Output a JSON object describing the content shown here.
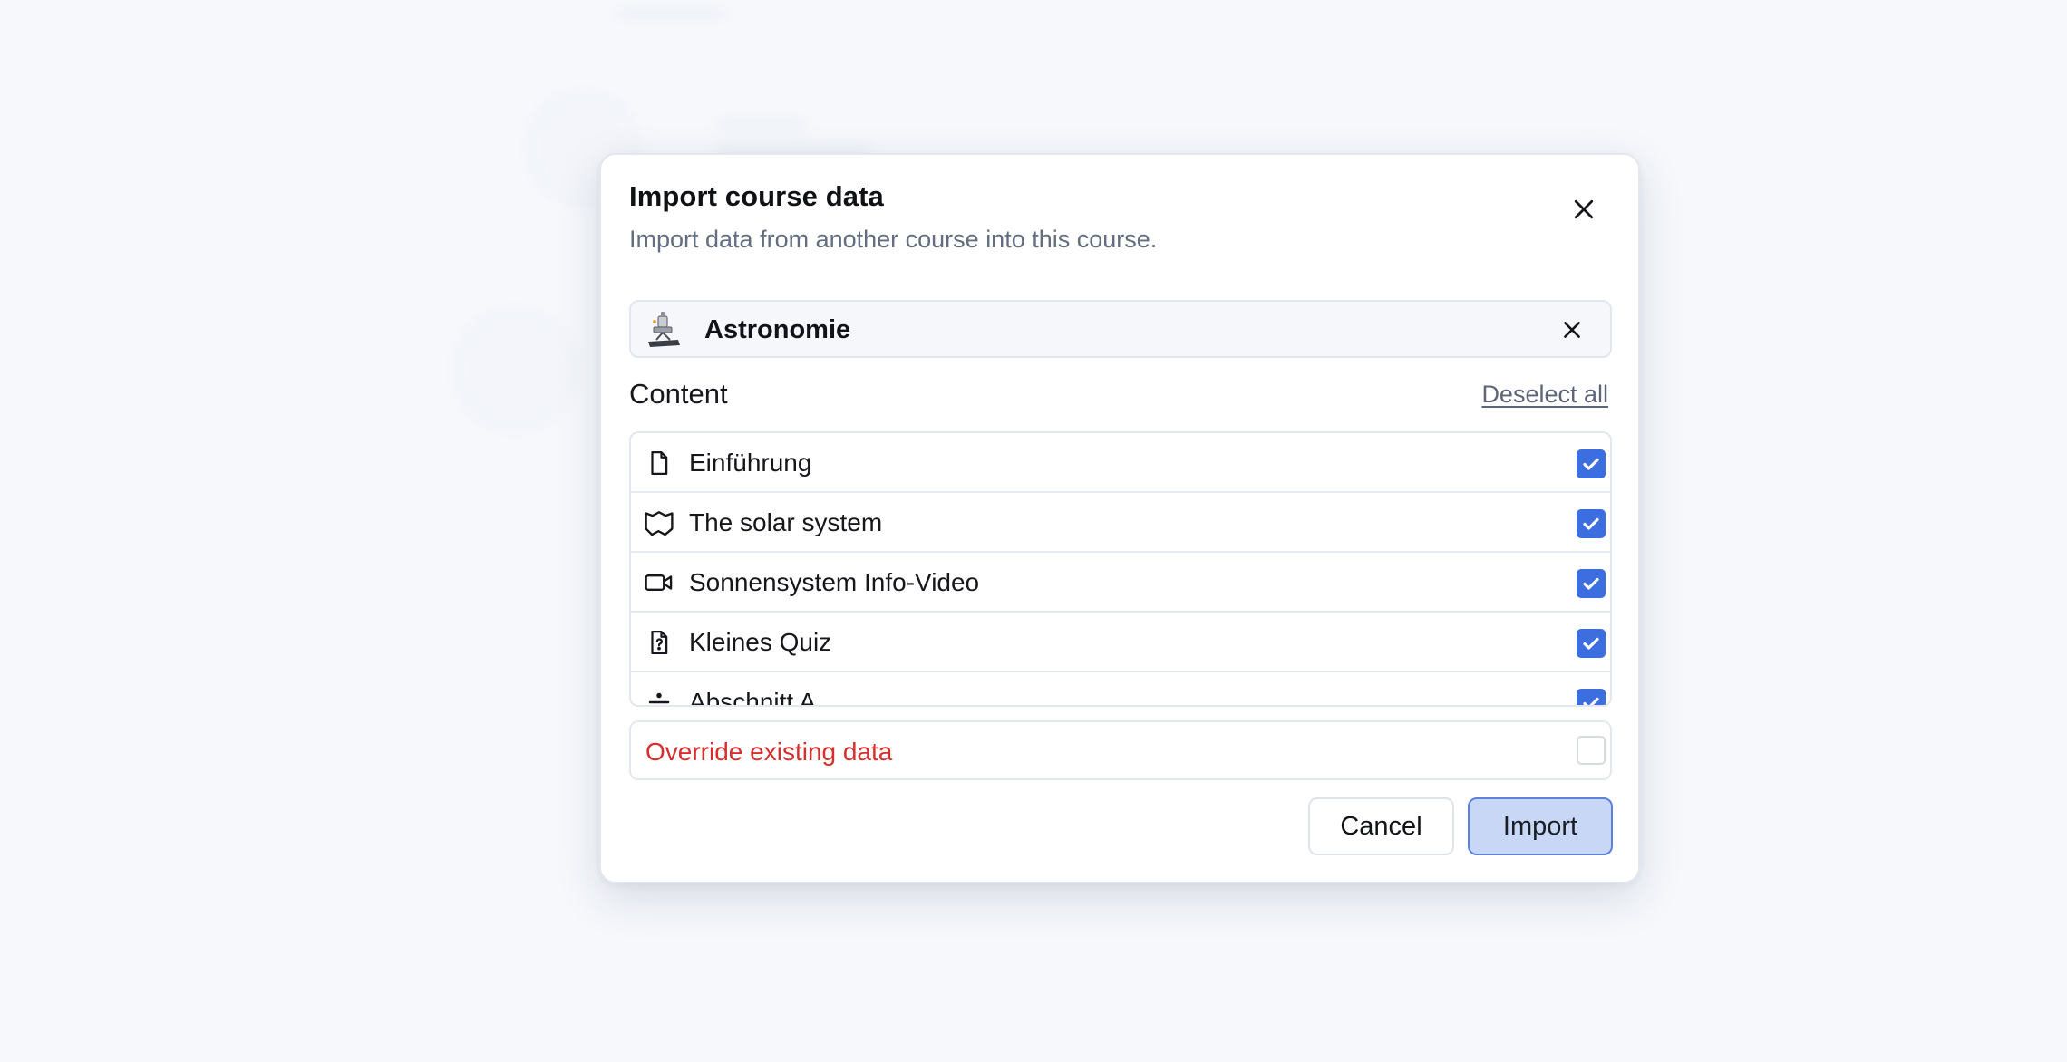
{
  "dialog": {
    "title": "Import course data",
    "subtitle": "Import data from another course into this course."
  },
  "course": {
    "name": "Astronomie"
  },
  "content": {
    "label": "Content",
    "deselect_all": "Deselect all",
    "items": [
      {
        "label": "Einführung",
        "icon": "document-icon",
        "checked": true
      },
      {
        "label": "The solar system",
        "icon": "map-icon",
        "checked": true
      },
      {
        "label": "Sonnensystem Info-Video",
        "icon": "video-icon",
        "checked": true
      },
      {
        "label": "Kleines Quiz",
        "icon": "quiz-icon",
        "checked": true
      },
      {
        "label": "Abschnitt A",
        "icon": "divider-icon",
        "checked": true
      }
    ]
  },
  "override": {
    "label": "Override existing data",
    "checked": false
  },
  "actions": {
    "cancel": "Cancel",
    "import": "Import"
  },
  "colors": {
    "accent": "#3d6ee0",
    "danger": "#d62f2f",
    "import_bg": "#c8d7f6"
  }
}
